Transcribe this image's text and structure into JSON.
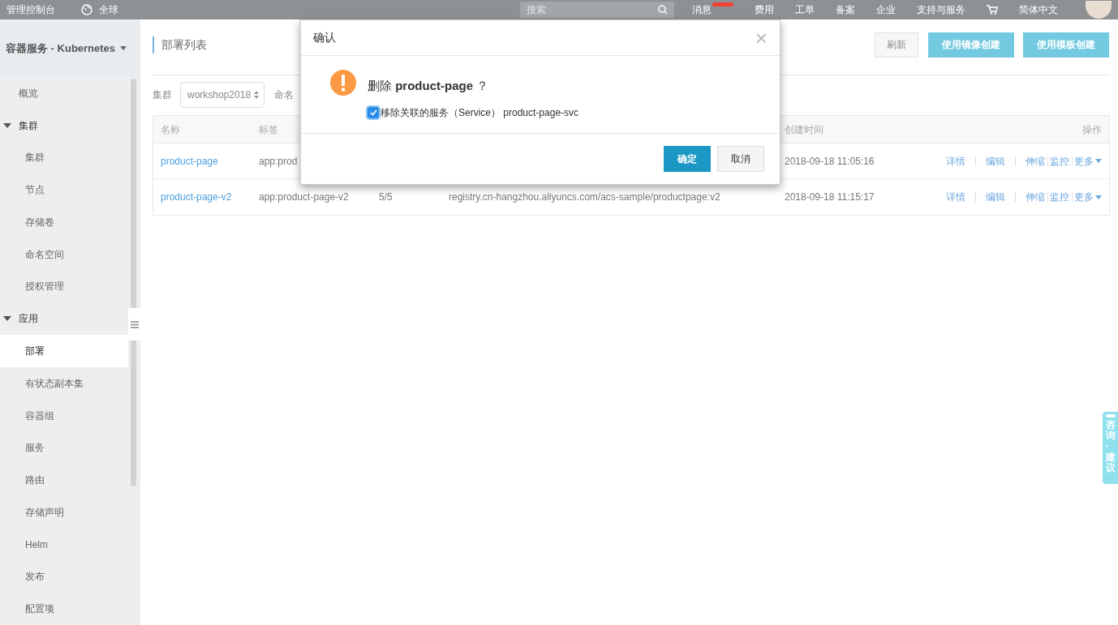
{
  "top_bar": {
    "console": "管理控制台",
    "region": "全球",
    "search": {
      "placeholder": "搜索"
    },
    "nav": [
      {
        "label": "消息",
        "badge": true
      },
      {
        "label": "费用",
        "badge": false
      },
      {
        "label": "工单",
        "badge": false
      },
      {
        "label": "备案",
        "badge": false
      },
      {
        "label": "企业",
        "badge": false
      },
      {
        "label": "支持与服务",
        "badge": false
      }
    ],
    "language": "简体中文"
  },
  "sidebar": {
    "title": "容器服务 - Kubernetes",
    "items": [
      {
        "kind": "item",
        "label": "概览",
        "selected": false
      },
      {
        "kind": "group",
        "label": "集群",
        "expanded": true,
        "children": [
          {
            "kind": "item",
            "label": "集群",
            "selected": false
          },
          {
            "kind": "item",
            "label": "节点",
            "selected": false
          },
          {
            "kind": "item",
            "label": "存储卷",
            "selected": false
          },
          {
            "kind": "item",
            "label": "命名空间",
            "selected": false
          },
          {
            "kind": "item",
            "label": "授权管理",
            "selected": false
          }
        ]
      },
      {
        "kind": "group",
        "label": "应用",
        "expanded": true,
        "children": [
          {
            "kind": "item",
            "label": "部署",
            "selected": true
          },
          {
            "kind": "item",
            "label": "有状态副本集",
            "selected": false
          },
          {
            "kind": "item",
            "label": "容器组",
            "selected": false
          },
          {
            "kind": "item",
            "label": "服务",
            "selected": false
          },
          {
            "kind": "item",
            "label": "路由",
            "selected": false
          },
          {
            "kind": "item",
            "label": "存储声明",
            "selected": false
          },
          {
            "kind": "item",
            "label": "Helm",
            "selected": false
          },
          {
            "kind": "item",
            "label": "发布",
            "selected": false
          },
          {
            "kind": "item",
            "label": "配置项",
            "selected": false
          }
        ]
      }
    ]
  },
  "main": {
    "title": "部署列表",
    "buttons": [
      {
        "label": "刷新",
        "kind": "default"
      },
      {
        "label": "使用镜像创建",
        "kind": "primary"
      },
      {
        "label": "使用模板创建",
        "kind": "primary"
      }
    ],
    "filters": {
      "cluster_label": "集群",
      "cluster_select": "workshop2018",
      "namespace_label": "命名"
    },
    "table": {
      "headers": {
        "name": "名称",
        "labels": "标签",
        "created": "创建时间",
        "actions": "操作"
      },
      "rows": [
        {
          "name": "product-page",
          "labels": "app:prod",
          "created": "2018-09-18 11:05:16",
          "actions": [
            "详情",
            "编辑",
            "伸缩",
            "监控",
            "更多"
          ]
        },
        {
          "name": "product-page-v2",
          "labels": "app:product-page-v2",
          "column_3": "5/5",
          "column_4": "registry.cn-hangzhou.aliyuncs.com/acs-sample/productpage:v2",
          "created": "2018-09-18 11:15:17",
          "actions": [
            "详情",
            "编辑",
            "伸缩",
            "监控",
            "更多"
          ]
        }
      ]
    }
  },
  "dialog": {
    "title": "确认",
    "close": "×",
    "message": "删除 **product-page** ？",
    "checkbox": {
      "label": "移除关联的服务（Service） product-page-svc",
      "checked": true
    },
    "buttons": [
      {
        "label": "确定",
        "kind": "primary"
      },
      {
        "label": "取消",
        "kind": "default"
      }
    ]
  },
  "feedback_tab": {
    "label": "咨询·建议"
  }
}
